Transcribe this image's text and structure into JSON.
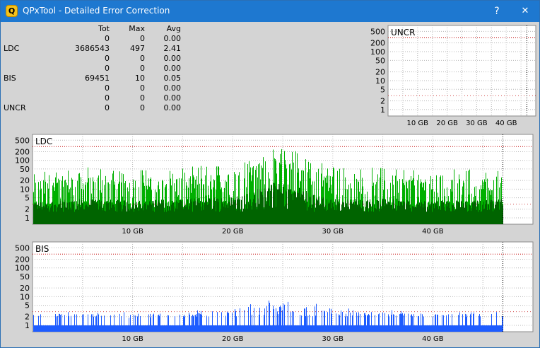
{
  "window": {
    "title": "QPxTool - Detailed Error Correction",
    "icon_letter": "Q",
    "help_label": "?",
    "close_label": "✕"
  },
  "stats": {
    "headers": {
      "tot": "Tot",
      "max": "Max",
      "avg": "Avg"
    },
    "rows": [
      {
        "label": "",
        "tot": "0",
        "max": "0",
        "avg": "0.00"
      },
      {
        "label": "LDC",
        "tot": "3686543",
        "max": "497",
        "avg": "2.41"
      },
      {
        "label": "",
        "tot": "0",
        "max": "0",
        "avg": "0.00"
      },
      {
        "label": "",
        "tot": "0",
        "max": "0",
        "avg": "0.00"
      },
      {
        "label": "BIS",
        "tot": "69451",
        "max": "10",
        "avg": "0.05"
      },
      {
        "label": "",
        "tot": "0",
        "max": "0",
        "avg": "0.00"
      },
      {
        "label": "",
        "tot": "0",
        "max": "0",
        "avg": "0.00"
      },
      {
        "label": "UNCR",
        "tot": "0",
        "max": "0",
        "avg": "0.00"
      }
    ]
  },
  "chart_data": [
    {
      "type": "bar",
      "title": "UNCR",
      "y_ticks": [
        1,
        2,
        5,
        10,
        20,
        50,
        100,
        200,
        500
      ],
      "y_scale": "log",
      "x_ticks": [
        "10 GB",
        "20 GB",
        "30 GB",
        "40 GB"
      ],
      "x_tick_values": [
        10,
        20,
        30,
        40
      ],
      "x_range": [
        0,
        50
      ],
      "data_end_gb": 47,
      "max": 0,
      "values": [],
      "grid": true,
      "threshold_color": "#c00000"
    },
    {
      "type": "bar",
      "title": "LDC",
      "y_ticks": [
        1,
        2,
        5,
        10,
        20,
        50,
        100,
        200,
        500
      ],
      "y_scale": "log",
      "x_ticks": [
        "10 GB",
        "20 GB",
        "30 GB",
        "40 GB"
      ],
      "x_tick_values": [
        10,
        20,
        30,
        40
      ],
      "x_range": [
        0,
        50
      ],
      "data_end_gb": 47,
      "max": 497,
      "avg": 2.41,
      "series_color": "#00b000",
      "secondary_color": "#006400",
      "profile_gb": [
        0,
        5,
        10,
        15,
        20,
        22,
        24,
        26,
        28,
        30,
        35,
        40,
        45,
        47
      ],
      "profile_peak": [
        40,
        60,
        50,
        60,
        80,
        150,
        300,
        250,
        100,
        60,
        60,
        50,
        50,
        60
      ],
      "grid": true,
      "threshold_color": "#c00000"
    },
    {
      "type": "bar",
      "title": "BIS",
      "y_ticks": [
        1,
        2,
        5,
        10,
        20,
        50,
        100,
        200,
        500
      ],
      "y_scale": "log",
      "x_ticks": [
        "10 GB",
        "20 GB",
        "30 GB",
        "40 GB"
      ],
      "x_tick_values": [
        10,
        20,
        30,
        40
      ],
      "x_range": [
        0,
        50
      ],
      "data_end_gb": 47,
      "max": 10,
      "avg": 0.05,
      "series_color": "#1e5cff",
      "profile_gb": [
        0,
        10,
        20,
        22,
        24,
        26,
        28,
        30,
        40,
        47
      ],
      "profile_peak": [
        3,
        3,
        4,
        6,
        8,
        8,
        6,
        4,
        3,
        3
      ],
      "grid": true,
      "threshold_color": "#c00000"
    }
  ]
}
